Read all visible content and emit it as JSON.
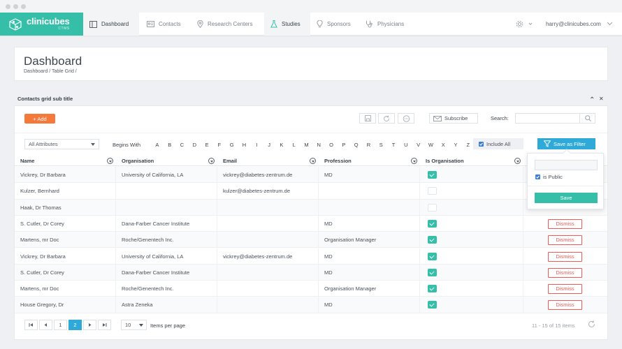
{
  "brand": {
    "name": "clinicubes",
    "sub": "CTMS",
    "color": "#35bfa8"
  },
  "nav": {
    "items": [
      {
        "label": "Dashboard",
        "icon": "dashboard-icon",
        "active": true
      },
      {
        "label": "Contacts",
        "icon": "contact-card-icon",
        "active": false
      },
      {
        "label": "Research Centers",
        "icon": "map-pin-icon",
        "active": false
      },
      {
        "label": "Studies",
        "icon": "flask-icon",
        "active": true
      },
      {
        "label": "Sponsors",
        "icon": "lightbulb-icon",
        "active": false
      },
      {
        "label": "Physicians",
        "icon": "stethoscope-icon",
        "active": false
      }
    ],
    "user": "harry@clinicubes.com"
  },
  "header": {
    "title": "Dashboard",
    "breadcrumb": "Dashboard  /  Table Grid  /"
  },
  "grid": {
    "subtitle": "Contacts grid sub title",
    "collapse_glyph": "⌃",
    "close_glyph": "✕",
    "add_label": "+ Add",
    "subscribe_label": "Subscribe",
    "search_label": "Search:",
    "search_value": "",
    "attribute_select": "All Attributes",
    "begins_with": "Begins With",
    "letters": [
      "A",
      "B",
      "C",
      "D",
      "E",
      "F",
      "G",
      "H",
      "I",
      "J",
      "K",
      "L",
      "M",
      "N",
      "O",
      "P",
      "Q",
      "R",
      "S",
      "T",
      "U",
      "V",
      "W",
      "X",
      "Y",
      "Z"
    ],
    "include_all": "Include All",
    "save_as_filter": "Save as Filter",
    "columns": [
      "Name",
      "Organisation",
      "Email",
      "Profession",
      "Is Organisation"
    ],
    "rows": [
      {
        "name": "Vickrey, Dr Barbara",
        "org": "University of California, LA",
        "email": "vickrey@diabetes-zentrum.de",
        "profession": "MD",
        "is_org": true,
        "dismiss": ""
      },
      {
        "name": "Kulzer, Bernhard",
        "org": "",
        "email": "kulzer@diabetes-zentrum.de",
        "profession": "",
        "is_org": false,
        "dismiss": ""
      },
      {
        "name": "Haak, Dr Thomas",
        "org": "",
        "email": "",
        "profession": "",
        "is_org": false,
        "dismiss": ""
      },
      {
        "name": "S. Cutler, Dr Corey",
        "org": "Dana-Farber Cancer Institute",
        "email": "",
        "profession": "MD",
        "is_org": true,
        "dismiss": "Dismiss"
      },
      {
        "name": "Martens, mr Doc",
        "org": "Roche/Genentech Inc.",
        "email": "",
        "profession": "Organisation Manager",
        "is_org": true,
        "dismiss": "Dismiss"
      },
      {
        "name": "Vickrey, Dr Barbara",
        "org": "University of California, LA",
        "email": "vickrey@diabetes-zentrum.de",
        "profession": "MD",
        "is_org": true,
        "dismiss": "Dismiss"
      },
      {
        "name": "S. Cutler, Dr Corey",
        "org": "Dana-Farber Cancer Institute",
        "email": "",
        "profession": "MD",
        "is_org": true,
        "dismiss": "Dismiss"
      },
      {
        "name": "Martens, mr Doc",
        "org": "Roche/Genentech Inc.",
        "email": "",
        "profession": "Organisation Manager",
        "is_org": true,
        "dismiss": "Dismiss"
      },
      {
        "name": "House Gregory, Dr",
        "org": "Astra Zeneka",
        "email": "",
        "profession": "MD",
        "is_org": true,
        "dismiss": "Dismiss"
      }
    ],
    "pager": {
      "first": "|◀",
      "prev": "◀",
      "pages": [
        "1",
        "2"
      ],
      "current": "2",
      "next": "▶",
      "last": "▶|"
    },
    "per_page_value": "10",
    "per_page_label": "Items per page",
    "items_info": "11 - 15 of 15 items"
  },
  "filter_popover": {
    "name_value": "",
    "is_public_label": "is Public",
    "is_public": true,
    "save_label": "Save"
  },
  "colors": {
    "teal": "#35bfa8",
    "orange": "#f5793b",
    "blue": "#2fa9d8",
    "danger": "#ef5a58"
  }
}
